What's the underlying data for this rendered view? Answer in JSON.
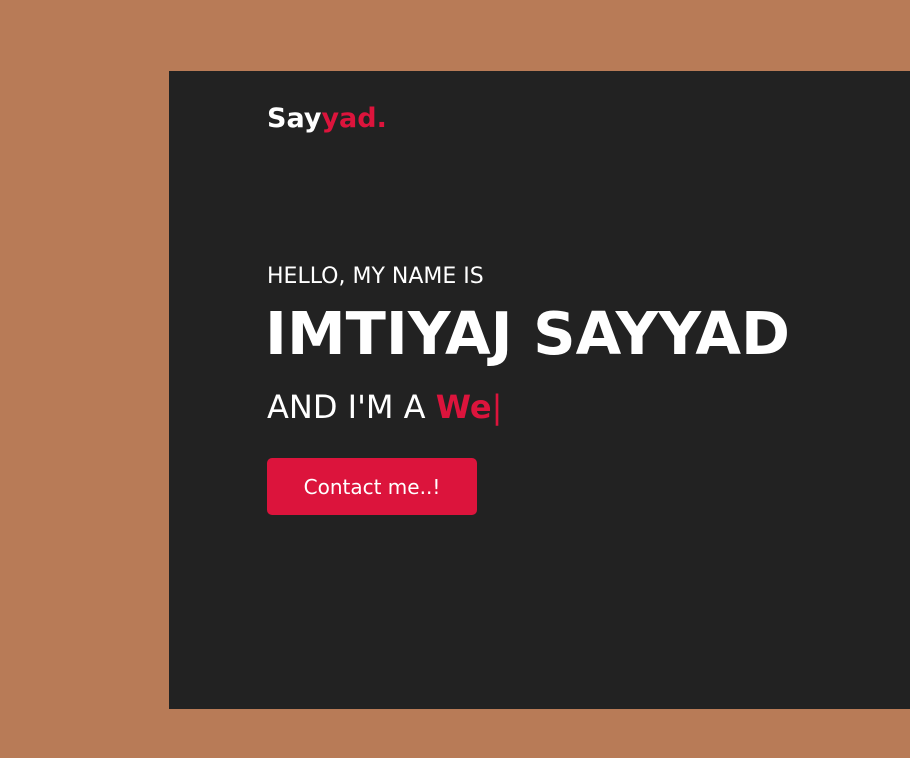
{
  "navbar": {
    "logo_primary": "Say",
    "logo_accent": "yad."
  },
  "hero": {
    "greeting": "HELLO, MY NAME IS",
    "name": "IMTIYAJ SAYYAD",
    "role_prefix": "AND I'M A ",
    "role_typed": "We",
    "cursor": "|",
    "contact_button_label": "Contact me..!"
  },
  "colors": {
    "page_background": "#b87b57",
    "section_background": "#222222",
    "accent": "#dc143c",
    "text": "#ffffff"
  }
}
